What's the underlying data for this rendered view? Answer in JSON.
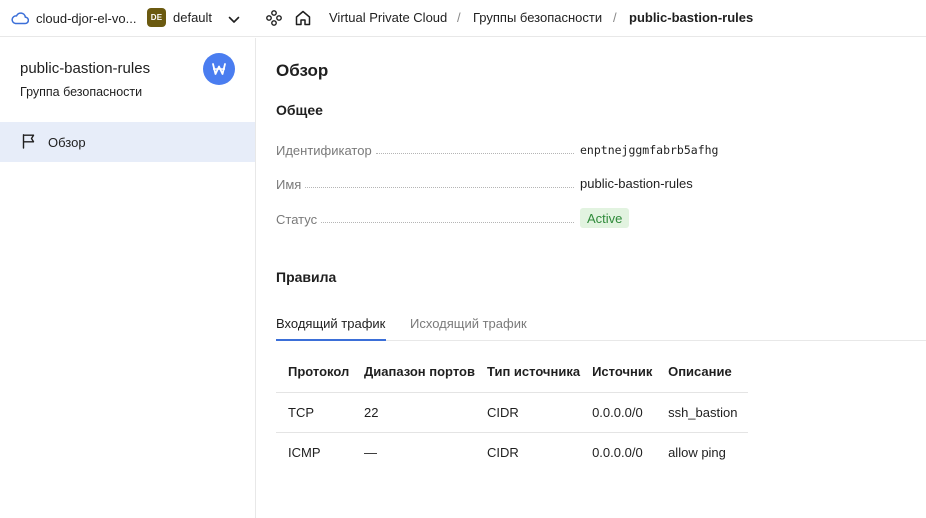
{
  "topbar": {
    "cloud_name": "cloud-djor-el-vo...",
    "folder_badge": "DE",
    "folder_name": "default",
    "breadcrumbs": [
      "Virtual Private Cloud",
      "Группы безопасности",
      "public-bastion-rules"
    ],
    "separator": "/"
  },
  "sidebar": {
    "title": "public-bastion-rules",
    "subtitle": "Группа безопасности",
    "items": [
      {
        "label": "Обзор",
        "icon": "flag-icon",
        "active": true
      }
    ]
  },
  "main": {
    "heading": "Обзор",
    "general_heading": "Общее",
    "properties": {
      "id_label": "Идентификатор",
      "id_value": "enptnejggmfabrb5afhg",
      "name_label": "Имя",
      "name_value": "public-bastion-rules",
      "status_label": "Статус",
      "status_value": "Active"
    },
    "rules_heading": "Правила",
    "tabs": [
      {
        "label": "Входящий трафик",
        "active": true
      },
      {
        "label": "Исходящий трафик",
        "active": false
      }
    ],
    "table": {
      "headers": [
        "Протокол",
        "Диапазон портов",
        "Тип источника",
        "Источник",
        "Описание"
      ],
      "rows": [
        [
          "TCP",
          "22",
          "CIDR",
          "0.0.0.0/0",
          "ssh_bastion"
        ],
        [
          "ICMP",
          "—",
          "CIDR",
          "0.0.0.0/0",
          "allow ping"
        ]
      ]
    }
  },
  "colors": {
    "accent": "#3b6fd8",
    "active_nav_bg": "#e7edf9",
    "status_bg": "#e2f3e0",
    "status_text": "#2f8a3a",
    "folder_badge_bg": "#6b5a10",
    "avatar_bg": "#4a7df0"
  }
}
